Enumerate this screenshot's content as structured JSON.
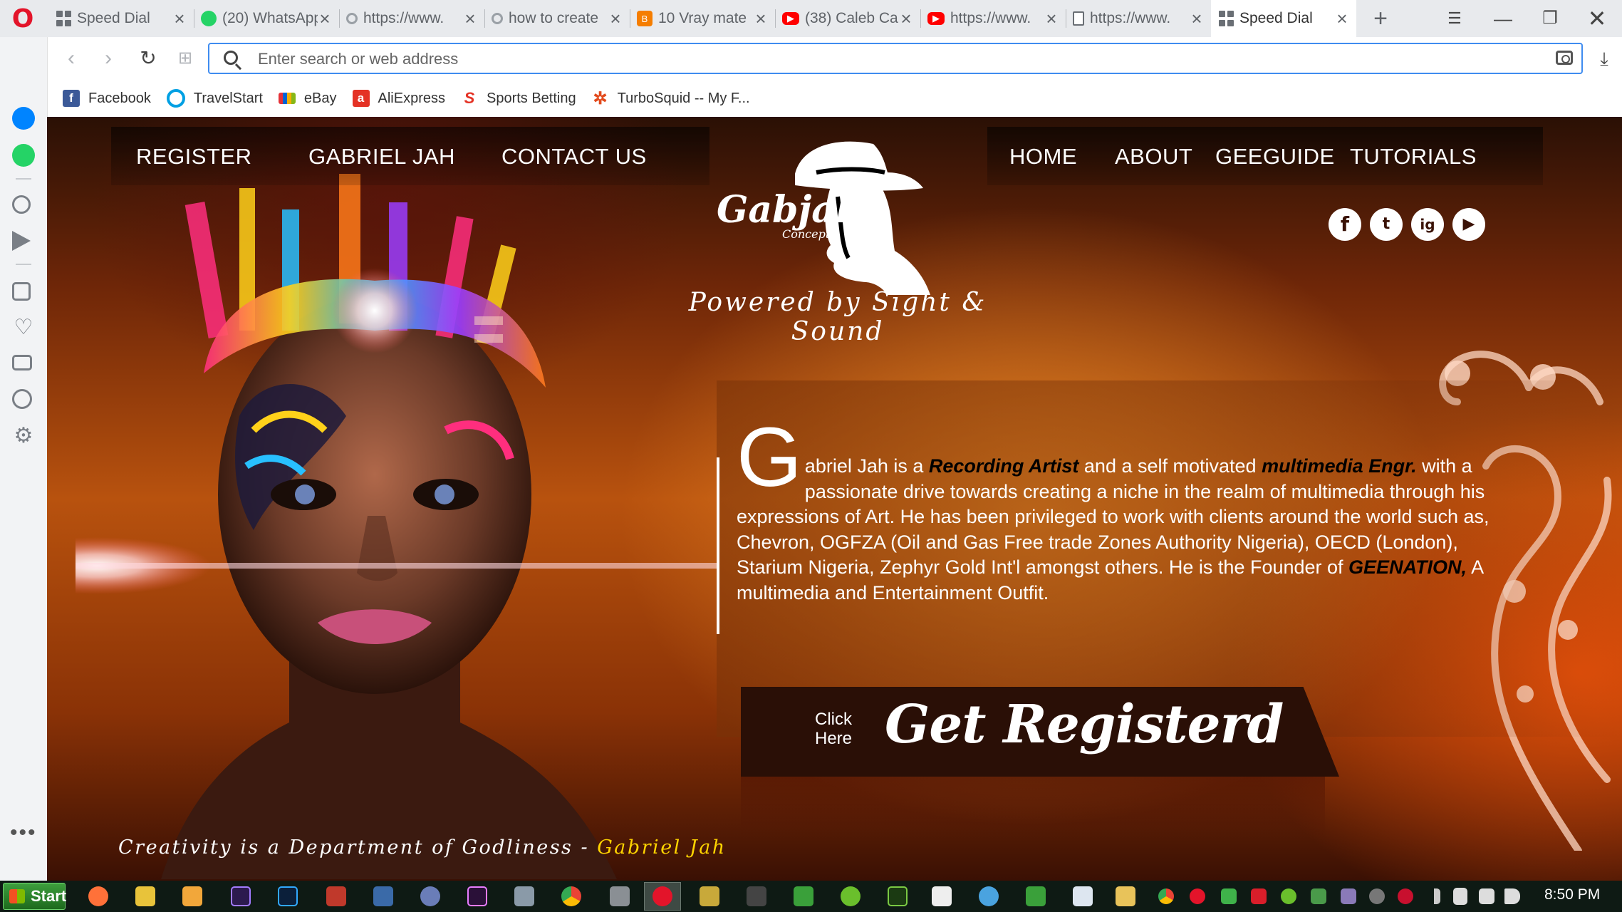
{
  "browser": {
    "tabs": [
      {
        "title": "Speed Dial",
        "favicon": "speed-dial-grid"
      },
      {
        "title": "(20) WhatsApp",
        "favicon": "whatsapp"
      },
      {
        "title": "https://www.",
        "favicon": "loading"
      },
      {
        "title": "how to create",
        "favicon": "loading"
      },
      {
        "title": "10 Vray mate",
        "favicon": "blogger"
      },
      {
        "title": "(38) Caleb Ca",
        "favicon": "youtube"
      },
      {
        "title": "https://www.",
        "favicon": "youtube"
      },
      {
        "title": "https://www.",
        "favicon": "document"
      },
      {
        "title": "Speed Dial",
        "favicon": "speed-dial-grid",
        "active": true
      }
    ],
    "address_placeholder": "Enter search or web address",
    "bookmarks": [
      {
        "label": "Facebook",
        "icon": "facebook-icon",
        "color": "#3b5998"
      },
      {
        "label": "TravelStart",
        "icon": "travelstart-icon",
        "color": "#00a0e3"
      },
      {
        "label": "eBay",
        "icon": "ebay-icon",
        "color": "#333333"
      },
      {
        "label": "AliExpress",
        "icon": "aliexpress-icon",
        "color": "#e43225"
      },
      {
        "label": "Sports Betting",
        "icon": "sportsbet-icon",
        "color": "#e43225"
      },
      {
        "label": "TurboSquid -- My F...",
        "icon": "turbosquid-icon",
        "color": "#e24a1c"
      }
    ]
  },
  "site": {
    "nav_left": [
      "REGISTER",
      "GABRIEL JAH",
      "CONTACT US"
    ],
    "nav_right": [
      "HOME",
      "ABOUT",
      "GEEGUIDE",
      "TUTORIALS"
    ],
    "logo_text": "Gabjah",
    "logo_subtext": "Concept",
    "tagline": "Powered by Sight & Sound",
    "social": [
      "f",
      "t",
      "ig",
      "▶"
    ],
    "bio": {
      "dropcap": "G",
      "p1": "abriel Jah is a ",
      "h1": "Recording Artist",
      "p2": " and a self motivated ",
      "h2": "multimedia Engr.",
      "p3": " with a passionate drive towards creating a niche in the realm of multimedia through his expressions of Art. He has been privileged to work with clients around the world such as, Chevron, OGFZA (Oil and Gas Free trade Zones Authority Nigeria),  OECD (London), Starium Nigeria, Zephyr Gold Int'l amongst others. He is the Founder of ",
      "h3": "GEENATION,",
      "p4": " A multimedia and Entertainment Outfit."
    },
    "register": {
      "click_here": "Click Here",
      "cta": "Get Registerd"
    },
    "quote": "Creativity is a Department of Godliness - ",
    "quote_author": "Gabriel Jah"
  },
  "taskbar": {
    "start": "Start",
    "clock": "8:50 PM"
  }
}
